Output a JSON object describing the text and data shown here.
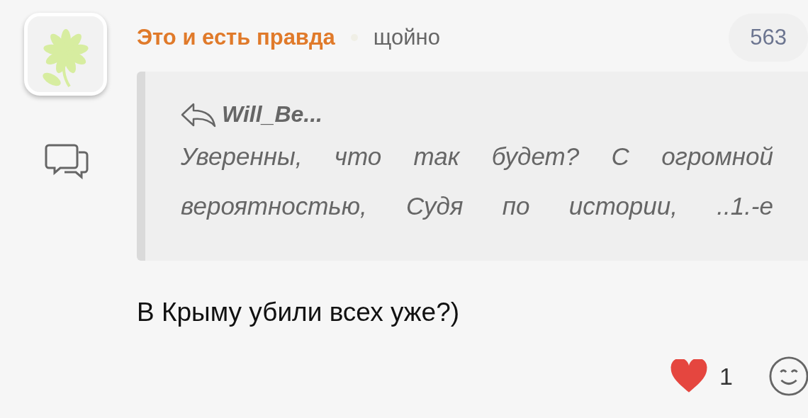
{
  "comment": {
    "author": "Это и есть правда",
    "time": "щойно",
    "count": "563",
    "quote": {
      "author": "Will_Be...",
      "text": "Уверенны, что так будет? С огромной вероятностью, Судя по истории, ..1.-е"
    },
    "text": "В Крыму убили всех уже?)",
    "reactions": [
      {
        "kind": "heart",
        "count": "1"
      }
    ]
  }
}
